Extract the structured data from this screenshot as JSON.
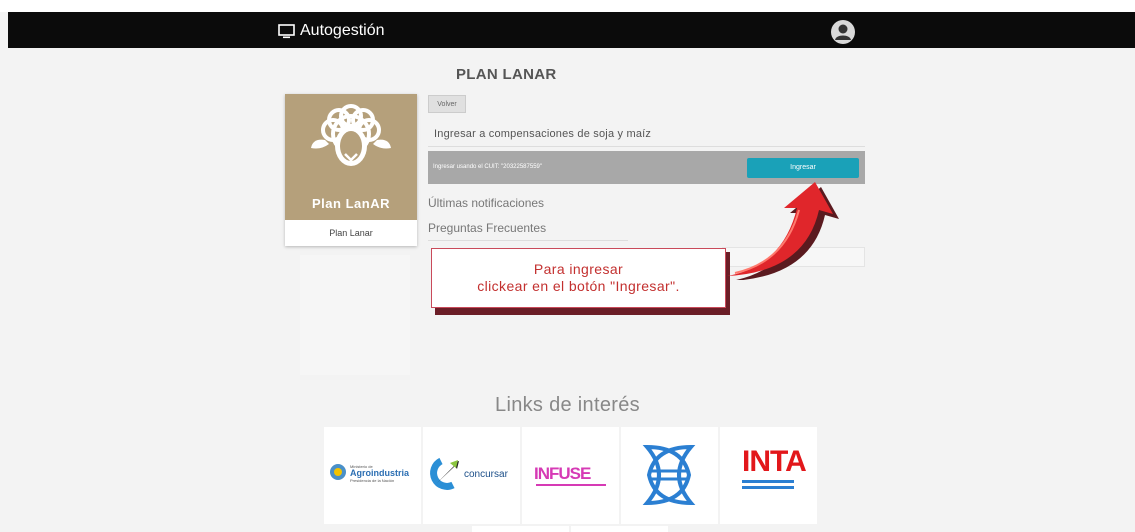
{
  "app": {
    "title": "Autogestión"
  },
  "page": {
    "title": "PLAN LANAR"
  },
  "card": {
    "logo_text": "Plan LanAR",
    "caption": "Plan Lanar"
  },
  "toolbar": {
    "back_label": "Volver"
  },
  "section": {
    "title": "Ingresar a compensaciones de soja y maíz",
    "cuit_text": "Ingresar usando el CUIT: \"20322587559\"",
    "enter_label": "Ingresar"
  },
  "links": {
    "notifications": "Últimas notificaciones",
    "faq": "Preguntas Frecuentes"
  },
  "callout": {
    "line1": "Para ingresar",
    "line2": "clickear en el botón \"Ingresar\"."
  },
  "links_section": {
    "title": "Links de interés"
  },
  "partners": [
    {
      "name": "Agroindustria",
      "top": "Ministerio de",
      "sub": "Presidencia de la Nación"
    },
    {
      "name": "concursar"
    },
    {
      "name": "INFUSE"
    },
    {
      "name": "fish-logo"
    },
    {
      "name": "INTA"
    }
  ],
  "colors": {
    "navbar": "#0b0b0b",
    "accent": "#1aa1b8",
    "callout_text": "#c3302f",
    "card_bg": "#b5a07b",
    "arrow": "#e0262b"
  },
  "icons": {
    "monitor": "monitor-icon",
    "user": "user-avatar-icon",
    "sheep": "sheep-icon",
    "arrow": "arrow-icon"
  }
}
